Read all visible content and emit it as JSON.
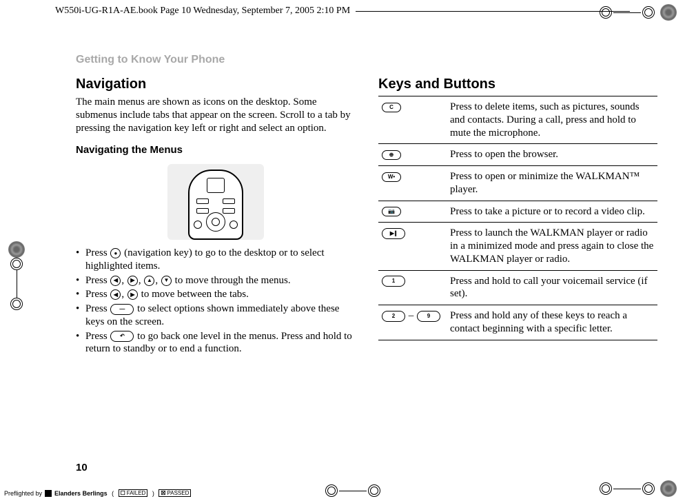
{
  "header_line": "W550i-UG-R1A-AE.book  Page 10  Wednesday, September 7, 2005  2:10 PM",
  "section_title": "Getting to Know Your Phone",
  "left": {
    "h2": "Navigation",
    "intro": "The main menus are shown as icons on the desktop. Some submenus include tabs that appear on the screen. Scroll to a tab by pressing the navigation key left or right and select an option.",
    "h3": "Navigating the Menus",
    "bullets": [
      {
        "pre": "Press ",
        "glyph": "●",
        "post": " (navigation key) to go to the desktop or to select highlighted items."
      },
      {
        "pre": "Press ",
        "glyphs": [
          "◐",
          "◑",
          "◓",
          "◒"
        ],
        "post": " to move through the menus."
      },
      {
        "pre": "Press ",
        "glyphs": [
          "◐",
          "◑"
        ],
        "post": " to move between the tabs."
      },
      {
        "pre": "Press ",
        "pill": "—",
        "post": " to select options shown immediately above these keys on the screen."
      },
      {
        "pre": "Press ",
        "pill": "↶",
        "post": " to go back one level in the menus. Press and hold to return to standby or to end a function."
      }
    ]
  },
  "right": {
    "h2": "Keys and Buttons",
    "rows": [
      {
        "key": "C",
        "desc": "Press to delete items, such as pictures, sounds and contacts. During a call, press and hold to mute the microphone."
      },
      {
        "key": "⊕",
        "desc": "Press to open the browser."
      },
      {
        "key": "W•",
        "desc": "Press to open or minimize the WALKMAN™ player."
      },
      {
        "key": "📷",
        "desc": "Press to take a picture or to record a video clip."
      },
      {
        "key": "▶∥",
        "desc": "Press to launch the WALKMAN player or radio in a minimized mode and press again to close the WALKMAN player or radio."
      },
      {
        "key": "1",
        "desc": "Press and hold to call your voicemail service (if set)."
      },
      {
        "key": "2",
        "key2": "9",
        "sep": " – ",
        "desc": "Press and hold any of these keys to reach a contact beginning with a specific letter."
      }
    ]
  },
  "page_num": "10",
  "footer": {
    "preflight": "Preflighted by",
    "company": "Elanders Berlings",
    "failed": "FAILED",
    "passed": "PASSED"
  }
}
